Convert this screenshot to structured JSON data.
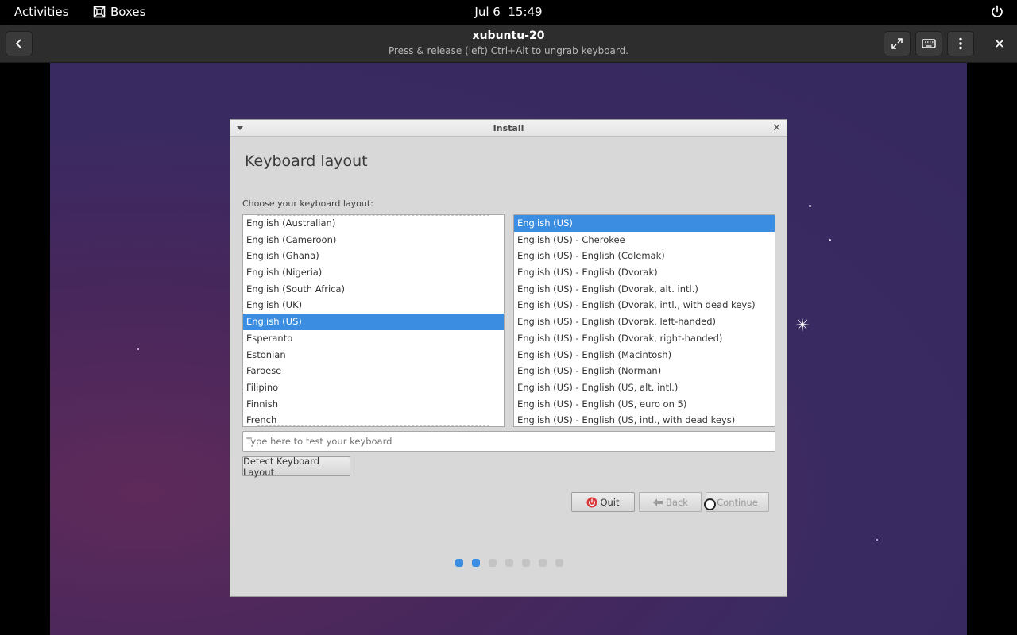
{
  "topbar": {
    "activities": "Activities",
    "app_name": "Boxes",
    "clock_date": "Jul 6",
    "clock_time": "15:49"
  },
  "header": {
    "title": "xubuntu-20",
    "subtitle": "Press & release (left) Ctrl+Alt to ungrab keyboard."
  },
  "installer": {
    "window_title": "Install",
    "heading": "Keyboard layout",
    "choose_label": "Choose your keyboard layout:",
    "layouts": [
      "English (Australian)",
      "English (Cameroon)",
      "English (Ghana)",
      "English (Nigeria)",
      "English (South Africa)",
      "English (UK)",
      "English (US)",
      "Esperanto",
      "Estonian",
      "Faroese",
      "Filipino",
      "Finnish",
      "French"
    ],
    "selected_layout": "English (US)",
    "variants": [
      "English (US)",
      "English (US) - Cherokee",
      "English (US) - English (Colemak)",
      "English (US) - English (Dvorak)",
      "English (US) - English (Dvorak, alt. intl.)",
      "English (US) - English (Dvorak, intl., with dead keys)",
      "English (US) - English (Dvorak, left-handed)",
      "English (US) - English (Dvorak, right-handed)",
      "English (US) - English (Macintosh)",
      "English (US) - English (Norman)",
      "English (US) - English (US, alt. intl.)",
      "English (US) - English (US, euro on 5)",
      "English (US) - English (US, intl., with dead keys)"
    ],
    "selected_variant": "English (US)",
    "test_placeholder": "Type here to test your keyboard",
    "detect_label": "Detect Keyboard Layout",
    "quit_label": "Quit",
    "back_label": "Back",
    "continue_label": "Continue",
    "progress": {
      "total_steps": 7,
      "completed_steps": 2
    }
  },
  "colors": {
    "accent": "#3a8de0",
    "quit_icon": "#d63a3a",
    "vm_background": "#3a2a62"
  }
}
